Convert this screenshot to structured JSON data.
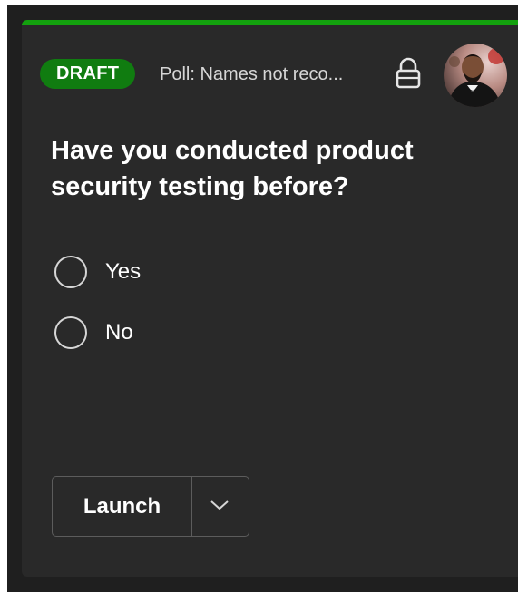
{
  "card": {
    "accent_color": "#13a10e",
    "status_badge": "DRAFT",
    "poll_title": "Poll: Names not reco...",
    "lock_icon": "lock-icon",
    "avatar": "user-avatar-photo"
  },
  "poll": {
    "question": "Have you conducted product security testing before?",
    "options": [
      {
        "label": "Yes",
        "selected": false
      },
      {
        "label": "No",
        "selected": false
      }
    ]
  },
  "actions": {
    "launch_label": "Launch",
    "dropdown_icon": "chevron-down-icon"
  }
}
